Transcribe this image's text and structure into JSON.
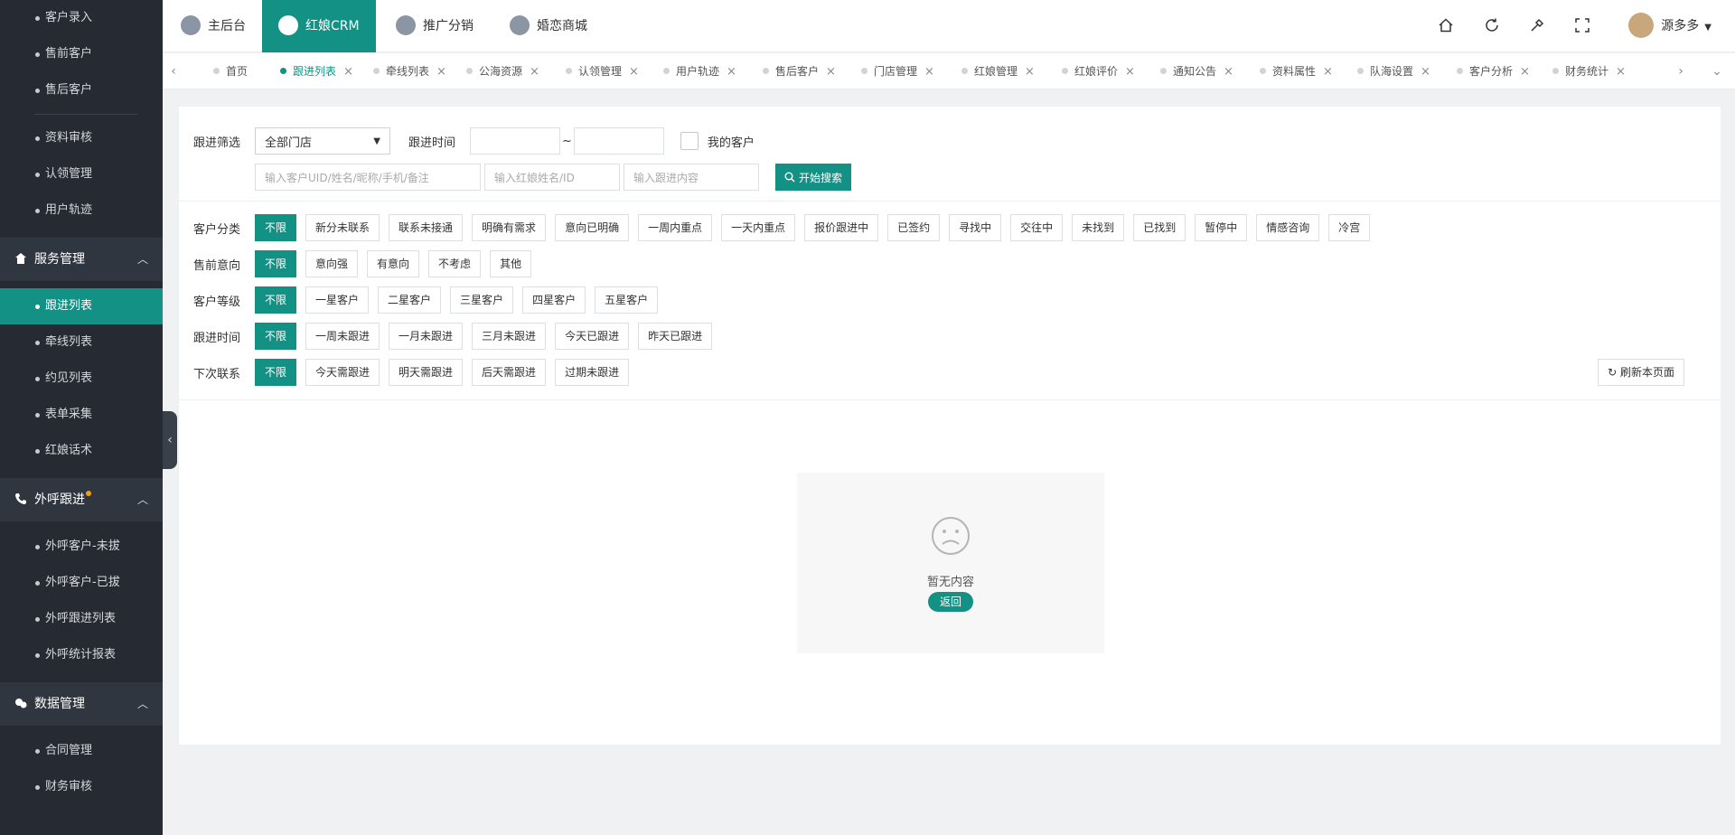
{
  "sidebar": {
    "top_items": [
      "客户录入",
      "售前客户",
      "售后客户"
    ],
    "items2": [
      "资料审核",
      "认领管理",
      "用户轨迹"
    ],
    "groups": [
      {
        "title": "服务管理",
        "items": [
          "跟进列表",
          "牵线列表",
          "约见列表",
          "表单采集",
          "红娘话术"
        ]
      },
      {
        "title": "外呼跟进",
        "items": [
          "外呼客户-未拔",
          "外呼客户-已拔",
          "外呼跟进列表",
          "外呼统计报表"
        ]
      },
      {
        "title": "数据管理",
        "items": [
          "合同管理",
          "财务审核"
        ]
      }
    ],
    "active_item": "跟进列表",
    "colors": {
      "bg": "#262b33",
      "group_bg": "#30363f",
      "active": "#139184"
    }
  },
  "header": {
    "tabs": [
      "主后台",
      "红娘CRM",
      "推广分销",
      "婚恋商城"
    ],
    "active_tab": "红娘CRM",
    "icons": [
      "home-icon",
      "refresh-icon",
      "clear-icon",
      "fullscreen-icon"
    ],
    "user_name": "源多多"
  },
  "page_tabs": {
    "items": [
      "首页",
      "跟进列表",
      "牵线列表",
      "公海资源",
      "认领管理",
      "用户轨迹",
      "售后客户",
      "门店管理",
      "红娘管理",
      "红娘评价",
      "通知公告",
      "资料属性",
      "队海设置",
      "客户分析",
      "财务统计"
    ],
    "active": "跟进列表",
    "close_glyph": "×"
  },
  "filters": {
    "label_filter": "跟进筛选",
    "store_select": "全部门店",
    "label_time": "跟进时间",
    "range_sep": "~",
    "my_customers": "我的客户",
    "search_placeholders": [
      "输入客户UID/姓名/昵称/手机/备注",
      "输入红娘姓名/ID",
      "输入跟进内容"
    ],
    "search_button": "开始搜索"
  },
  "categories": [
    {
      "label": "客户分类",
      "options": [
        "不限",
        "新分未联系",
        "联系未接通",
        "明确有需求",
        "意向已明确",
        "一周内重点",
        "一天内重点",
        "报价跟进中",
        "已签约",
        "寻找中",
        "交往中",
        "未找到",
        "已找到",
        "暂停中",
        "情感咨询",
        "冷宫"
      ]
    },
    {
      "label": "售前意向",
      "options": [
        "不限",
        "意向强",
        "有意向",
        "不考虑",
        "其他"
      ]
    },
    {
      "label": "客户等级",
      "options": [
        "不限",
        "一星客户",
        "二星客户",
        "三星客户",
        "四星客户",
        "五星客户"
      ]
    },
    {
      "label": "跟进时间",
      "options": [
        "不限",
        "一周未跟进",
        "一月未跟进",
        "三月未跟进",
        "今天已跟进",
        "昨天已跟进"
      ]
    },
    {
      "label": "下次联系",
      "options": [
        "不限",
        "今天需跟进",
        "明天需跟进",
        "后天需跟进",
        "过期未跟进"
      ]
    }
  ],
  "refresh_button": "刷新本页面",
  "empty_state": {
    "text": "暂无内容",
    "back": "返回"
  }
}
